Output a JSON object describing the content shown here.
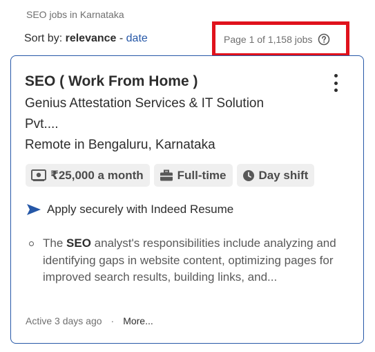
{
  "breadcrumb": "SEO jobs in Karnataka",
  "sort": {
    "prefix": "Sort by:",
    "active": "relevance",
    "separator": " - ",
    "other": "date"
  },
  "pagination": {
    "text": "Page 1 of 1,158 jobs",
    "help_icon": "question-circle-icon"
  },
  "job": {
    "title": "SEO ( Work From Home )",
    "company_line1": "Genius Attestation Services & IT Solution",
    "company_line2": "Pvt....",
    "location": "Remote in Bengaluru, Karnataka",
    "chips": {
      "salary": "₹25,000 a month",
      "type": "Full-time",
      "shift": "Day shift"
    },
    "apply_text": "Apply securely with Indeed Resume",
    "snippet_pre": "The ",
    "snippet_bold": "SEO",
    "snippet_post": " analyst's responsibilities include analyzing and identifying gaps in website content, optimizing pages for improved search results, building links, and...",
    "posted": "Active 3 days ago",
    "dot": "·",
    "more": "More..."
  },
  "colors": {
    "link": "#2557a7",
    "highlight_border": "#e0121c",
    "card_border": "#2557a7"
  }
}
